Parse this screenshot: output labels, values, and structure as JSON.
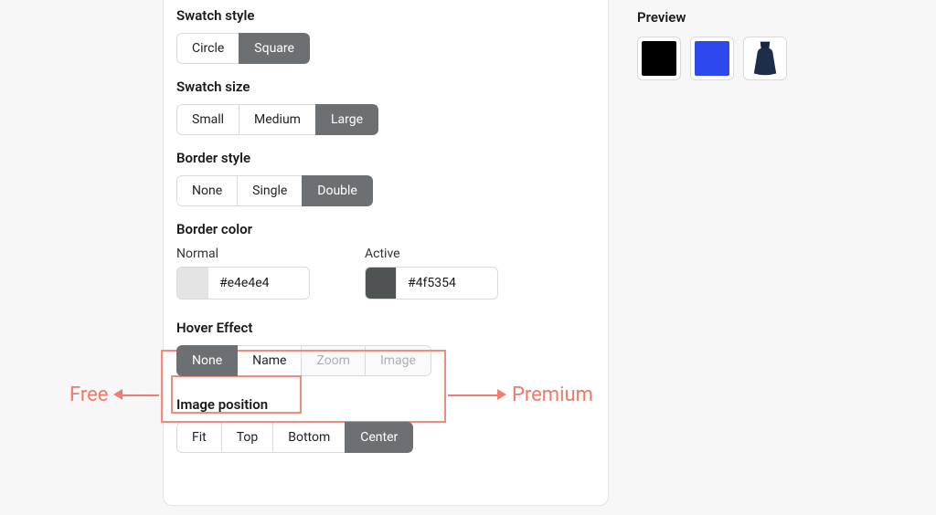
{
  "sections": {
    "swatch_style": {
      "label": "Swatch style",
      "options": [
        "Circle",
        "Square"
      ],
      "active": 1
    },
    "swatch_size": {
      "label": "Swatch size",
      "options": [
        "Small",
        "Medium",
        "Large"
      ],
      "active": 2
    },
    "border_style": {
      "label": "Border style",
      "options": [
        "None",
        "Single",
        "Double"
      ],
      "active": 2
    },
    "border_color": {
      "label": "Border color",
      "normal": {
        "label": "Normal",
        "value": "#e4e4e4",
        "swatch": "#e4e4e4"
      },
      "active": {
        "label": "Active",
        "value": "#4f5354",
        "swatch": "#4f5354"
      }
    },
    "hover_effect": {
      "label": "Hover Effect",
      "options": [
        "None",
        "Name",
        "Zoom",
        "Image"
      ],
      "active": 0,
      "disabled": [
        2,
        3
      ]
    },
    "image_position": {
      "label": "Image position",
      "options": [
        "Fit",
        "Top",
        "Bottom",
        "Center"
      ],
      "active": 3
    }
  },
  "preview": {
    "label": "Preview",
    "swatches": [
      {
        "type": "color",
        "value": "#000000"
      },
      {
        "type": "color",
        "value": "#2d49ee"
      },
      {
        "type": "image",
        "value": "dress-navy"
      }
    ]
  },
  "annotations": {
    "free": "Free",
    "premium": "Premium"
  }
}
